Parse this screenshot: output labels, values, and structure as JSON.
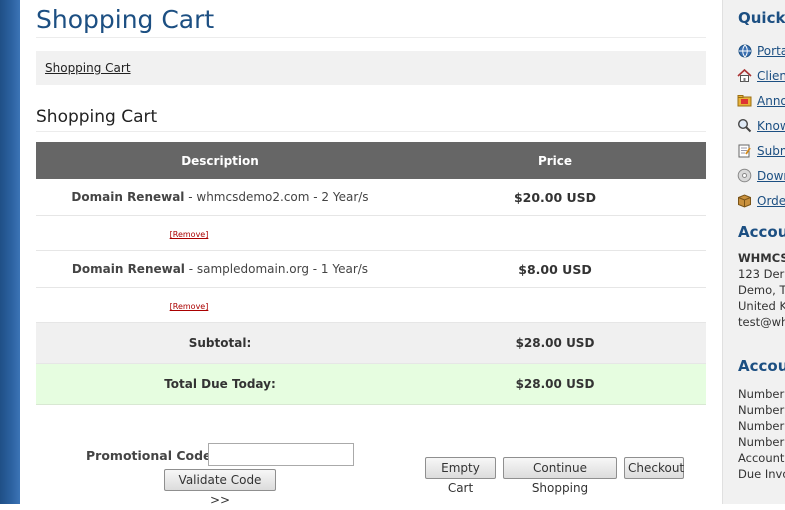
{
  "page": {
    "title": "Shopping Cart"
  },
  "breadcrumb": {
    "label": "Shopping Cart"
  },
  "section": {
    "title": "Shopping Cart"
  },
  "cart": {
    "headers": {
      "description": "Description",
      "price": "Price"
    },
    "items": [
      {
        "name": "Domain Renewal",
        "detail": " - whmcsdemo2.com - 2 Year/s",
        "price": "$20.00 USD",
        "remove": "[Remove]"
      },
      {
        "name": "Domain Renewal",
        "detail": " - sampledomain.org - 1 Year/s",
        "price": "$8.00 USD",
        "remove": "[Remove]"
      }
    ],
    "subtotal": {
      "label": "Subtotal:",
      "value": "$28.00 USD"
    },
    "total": {
      "label": "Total Due Today:",
      "value": "$28.00 USD"
    }
  },
  "promo": {
    "label": "Promotional Code",
    "value": "",
    "validate_label": "Validate Code >>"
  },
  "actions": {
    "empty": "Empty Cart",
    "continue": "Continue Shopping",
    "checkout": "Checkout"
  },
  "sidebar": {
    "quick_title": "Quick",
    "links": [
      {
        "label": "Porta",
        "icon": "globe-icon"
      },
      {
        "label": "Clien",
        "icon": "home-icon"
      },
      {
        "label": "Anno",
        "icon": "folder-icon"
      },
      {
        "label": "Know",
        "icon": "magnifier-icon"
      },
      {
        "label": "Subm",
        "icon": "notepad-icon"
      },
      {
        "label": "Down",
        "icon": "cd-icon"
      },
      {
        "label": "Orde",
        "icon": "box-icon"
      }
    ],
    "account_title": "Accou",
    "account_lines": [
      "WHMCS",
      "123 Der",
      "Demo, T",
      "United K",
      "test@wh"
    ],
    "account2_title": "Accou",
    "account2_lines": [
      "Number",
      "Number",
      "Number",
      "Number",
      "Account",
      "Due Invo"
    ]
  }
}
